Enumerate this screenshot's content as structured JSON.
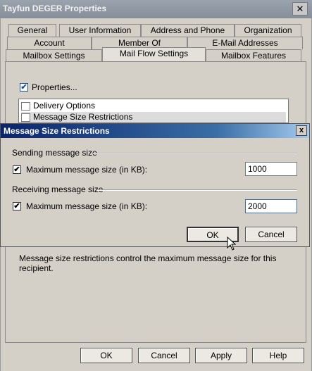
{
  "window": {
    "title": "Tayfun DEGER Properties",
    "close_label": "✕"
  },
  "tabs": {
    "row1": [
      "General",
      "User Information",
      "Address and Phone",
      "Organization"
    ],
    "row2": [
      "Account",
      "Member Of",
      "E-Mail Addresses"
    ],
    "row3": [
      "Mailbox Settings",
      "Mail Flow Settings",
      "Mailbox Features"
    ],
    "active": "Mail Flow Settings"
  },
  "mail_flow": {
    "properties_label": "Properties...",
    "properties_checked": true,
    "list_items": [
      "Delivery Options",
      "Message Size Restrictions"
    ],
    "selected_item": "Message Size Restrictions",
    "description": "Message size restrictions control the maximum message size for this recipient."
  },
  "dialog": {
    "title": "Message Size Restrictions",
    "close_label": "x",
    "sending": {
      "header": "Sending message size",
      "checkbox_label": "Maximum message size (in KB):",
      "checked": true,
      "value": "1000"
    },
    "receiving": {
      "header": "Receiving message size",
      "checkbox_label": "Maximum message size (in KB):",
      "checked": true,
      "value": "2000"
    },
    "ok_label": "OK",
    "cancel_label": "Cancel"
  },
  "footer": {
    "ok_label": "OK",
    "cancel_label": "Cancel",
    "apply_label": "Apply",
    "help_label": "Help"
  },
  "check_mark": "✔"
}
